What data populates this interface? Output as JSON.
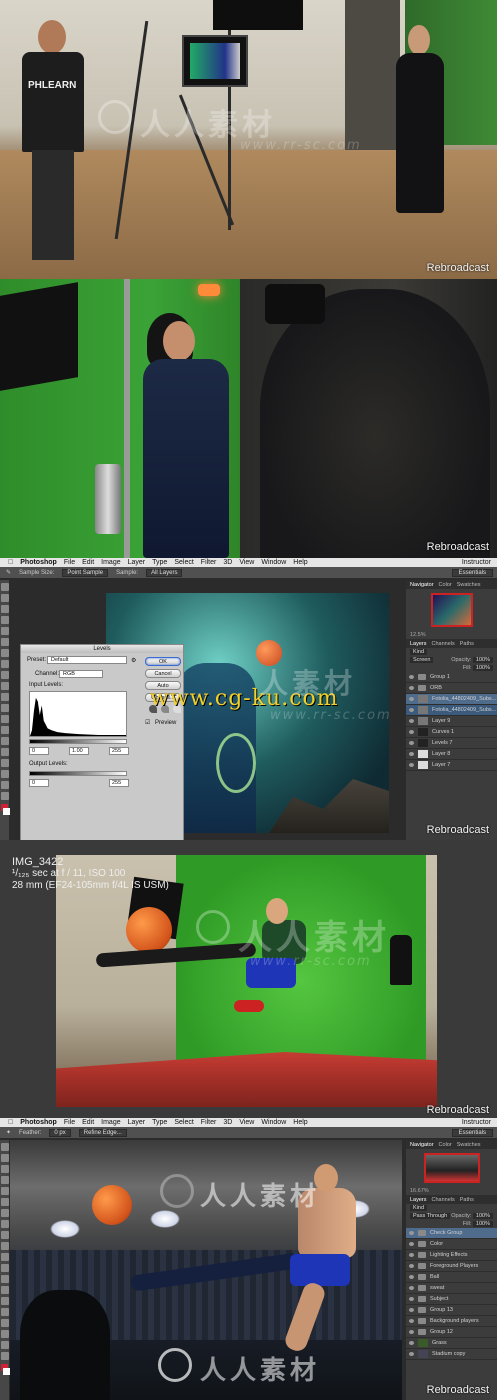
{
  "watermark": {
    "site_cn": "人人素材",
    "site_cn_short": "人素材",
    "site_url": "www.rr-sc.com",
    "cgku": "www.cg-ku.com"
  },
  "broadcast_label": "Rebroadcast",
  "panel1": {
    "shirt_text": "PHLEARN"
  },
  "photoshop_a": {
    "menubar": {
      "app": "Photoshop",
      "items": [
        "File",
        "Edit",
        "Image",
        "Layer",
        "Type",
        "Select",
        "Filter",
        "3D",
        "View",
        "Window",
        "Help"
      ],
      "right": "Instructor"
    },
    "options": {
      "sample_size_label": "Sample Size:",
      "sample_size_value": "Point Sample",
      "sample_label": "Sample:",
      "sample_value": "All Layers",
      "workspace": "Essentials"
    },
    "panel_tabs": [
      "Navigator",
      "Color",
      "Swatches"
    ],
    "zoom": "12.5%",
    "layer_tabs": [
      "Layers",
      "Channels",
      "Paths"
    ],
    "kind_label": "Kind",
    "blend_mode": "Screen",
    "opacity_label": "Opacity:",
    "opacity_value": "100%",
    "fill_label": "Fill:",
    "fill_value": "100%",
    "layers": [
      {
        "name": "Group 1",
        "type": "folder"
      },
      {
        "name": "ORB",
        "type": "folder"
      },
      {
        "name": "Fotolia_44802409_Subs...",
        "type": "layer",
        "selected": true
      },
      {
        "name": "Fotolia_44802409_Subs...",
        "type": "layer",
        "selected2": true
      },
      {
        "name": "Layer 9",
        "type": "layer"
      },
      {
        "name": "Curves 1",
        "type": "adjust"
      },
      {
        "name": "Levels 7",
        "type": "adjust"
      },
      {
        "name": "Layer 8",
        "type": "layer"
      },
      {
        "name": "Layer 7",
        "type": "layer"
      }
    ],
    "levels": {
      "title": "Levels",
      "preset_label": "Preset:",
      "preset_value": "Default",
      "channel_label": "Channel:",
      "channel_value": "RGB",
      "input_label": "Input Levels:",
      "input_values": [
        "0",
        "1.00",
        "255"
      ],
      "output_label": "Output Levels:",
      "output_values": [
        "0",
        "255"
      ],
      "ok": "OK",
      "cancel": "Cancel",
      "auto": "Auto",
      "options": "Options...",
      "preview_label": "Preview"
    }
  },
  "panel4": {
    "filename": "IMG_3422",
    "exposure_line": "¹/₁₂₅ sec at f / 11, ISO 100",
    "lens_line": "28 mm (EF24-105mm f/4L IS USM)"
  },
  "photoshop_b": {
    "menubar": {
      "app": "Photoshop",
      "items": [
        "File",
        "Edit",
        "Image",
        "Layer",
        "Type",
        "Select",
        "Filter",
        "3D",
        "View",
        "Window",
        "Help"
      ],
      "right": "Instructor"
    },
    "options": {
      "feather_label": "Feather:",
      "feather_value": "0 px",
      "refine_edge": "Refine Edge...",
      "workspace": "Essentials"
    },
    "panel_tabs": [
      "Navigator",
      "Color",
      "Swatches"
    ],
    "zoom": "16.67%",
    "layer_tabs": [
      "Layers",
      "Channels",
      "Paths"
    ],
    "kind_label": "Kind",
    "blend_mode": "Pass Through",
    "opacity_label": "Opacity:",
    "opacity_value": "100%",
    "fill_label": "Fill:",
    "fill_value": "100%",
    "layers": [
      {
        "name": "Check Group",
        "type": "folder",
        "selected": true
      },
      {
        "name": "Color",
        "type": "folder"
      },
      {
        "name": "Lighting Effects",
        "type": "folder"
      },
      {
        "name": "Foreground Players",
        "type": "folder"
      },
      {
        "name": "Ball",
        "type": "folder"
      },
      {
        "name": "sweat",
        "type": "folder"
      },
      {
        "name": "Subject",
        "type": "folder"
      },
      {
        "name": "Group 13",
        "type": "folder"
      },
      {
        "name": "Background players",
        "type": "folder"
      },
      {
        "name": "Group 12",
        "type": "folder"
      },
      {
        "name": "Grass",
        "type": "layer"
      },
      {
        "name": "Stadium copy",
        "type": "layer"
      }
    ]
  }
}
